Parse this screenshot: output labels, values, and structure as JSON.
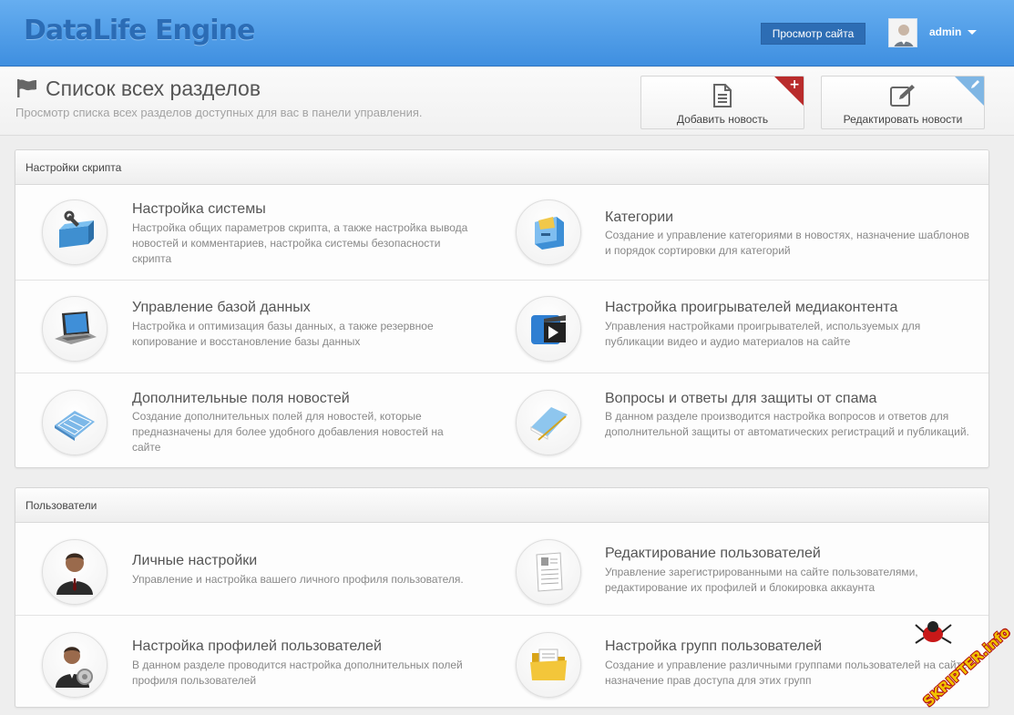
{
  "header": {
    "brand": "DataLife Engine",
    "view_site_label": "Просмотр сайта",
    "username": "admin"
  },
  "page": {
    "title": "Список всех разделов",
    "subtitle": "Просмотр списка всех разделов доступных для вас в панели управления.",
    "quick_buttons": [
      {
        "label": "Добавить новость",
        "icon": "document-icon",
        "badge_icon": "plus-icon",
        "badge_color": "#b92c2c"
      },
      {
        "label": "Редактировать новости",
        "icon": "edit-icon",
        "badge_icon": "pencil-icon",
        "badge_color": "#7fb6e4"
      }
    ]
  },
  "sections": [
    {
      "title": "Настройки скрипта",
      "items": [
        {
          "title": "Настройка системы",
          "desc": "Настройка общих параметров скрипта, а также настройка вывода новостей и комментариев, настройка системы безопасности скрипта",
          "icon": "toolbox-icon"
        },
        {
          "title": "Категории",
          "desc": "Создание и управление категориями в новостях, назначение шаблонов и порядок сортировки для категорий",
          "icon": "file-cabinet-icon"
        },
        {
          "title": "Управление базой данных",
          "desc": "Настройка и оптимизация базы данных, а также резервное копирование и восстановление базы данных",
          "icon": "laptop-icon"
        },
        {
          "title": "Настройка проигрывателей медиаконтента",
          "desc": "Управления настройками проигрывателей, используемых для публикации видео и аудио материалов на сайте",
          "icon": "media-clapper-icon"
        },
        {
          "title": "Дополнительные поля новостей",
          "desc": "Создание дополнительных полей для новостей, которые предназначены для более удобного добавления новостей на сайте",
          "icon": "blueprint-icon"
        },
        {
          "title": "Вопросы и ответы для защиты от спама",
          "desc": "В данном разделе производится настройка вопросов и ответов для дополнительной защиты от автоматических регистраций и публикаций.",
          "icon": "notepad-icon"
        }
      ]
    },
    {
      "title": "Пользователи",
      "items": [
        {
          "title": "Личные настройки",
          "desc": "Управление и настройка вашего личного профиля пользователя.",
          "icon": "user-icon"
        },
        {
          "title": "Редактирование пользователей",
          "desc": "Управление зарегистрированными на сайте пользователями, редактирование их профилей и блокировка аккаунта",
          "icon": "document-list-icon"
        },
        {
          "title": "Настройка профилей пользователей",
          "desc": "В данном разделе проводится настройка дополнительных полей профиля пользователей",
          "icon": "user-settings-icon"
        },
        {
          "title": "Настройка групп пользователей",
          "desc": "Создание и управление различными группами пользователей на сайте, назначение прав доступа для этих групп",
          "icon": "folder-icon"
        }
      ]
    }
  ],
  "watermark": {
    "text": "SKRIPTER.info"
  }
}
